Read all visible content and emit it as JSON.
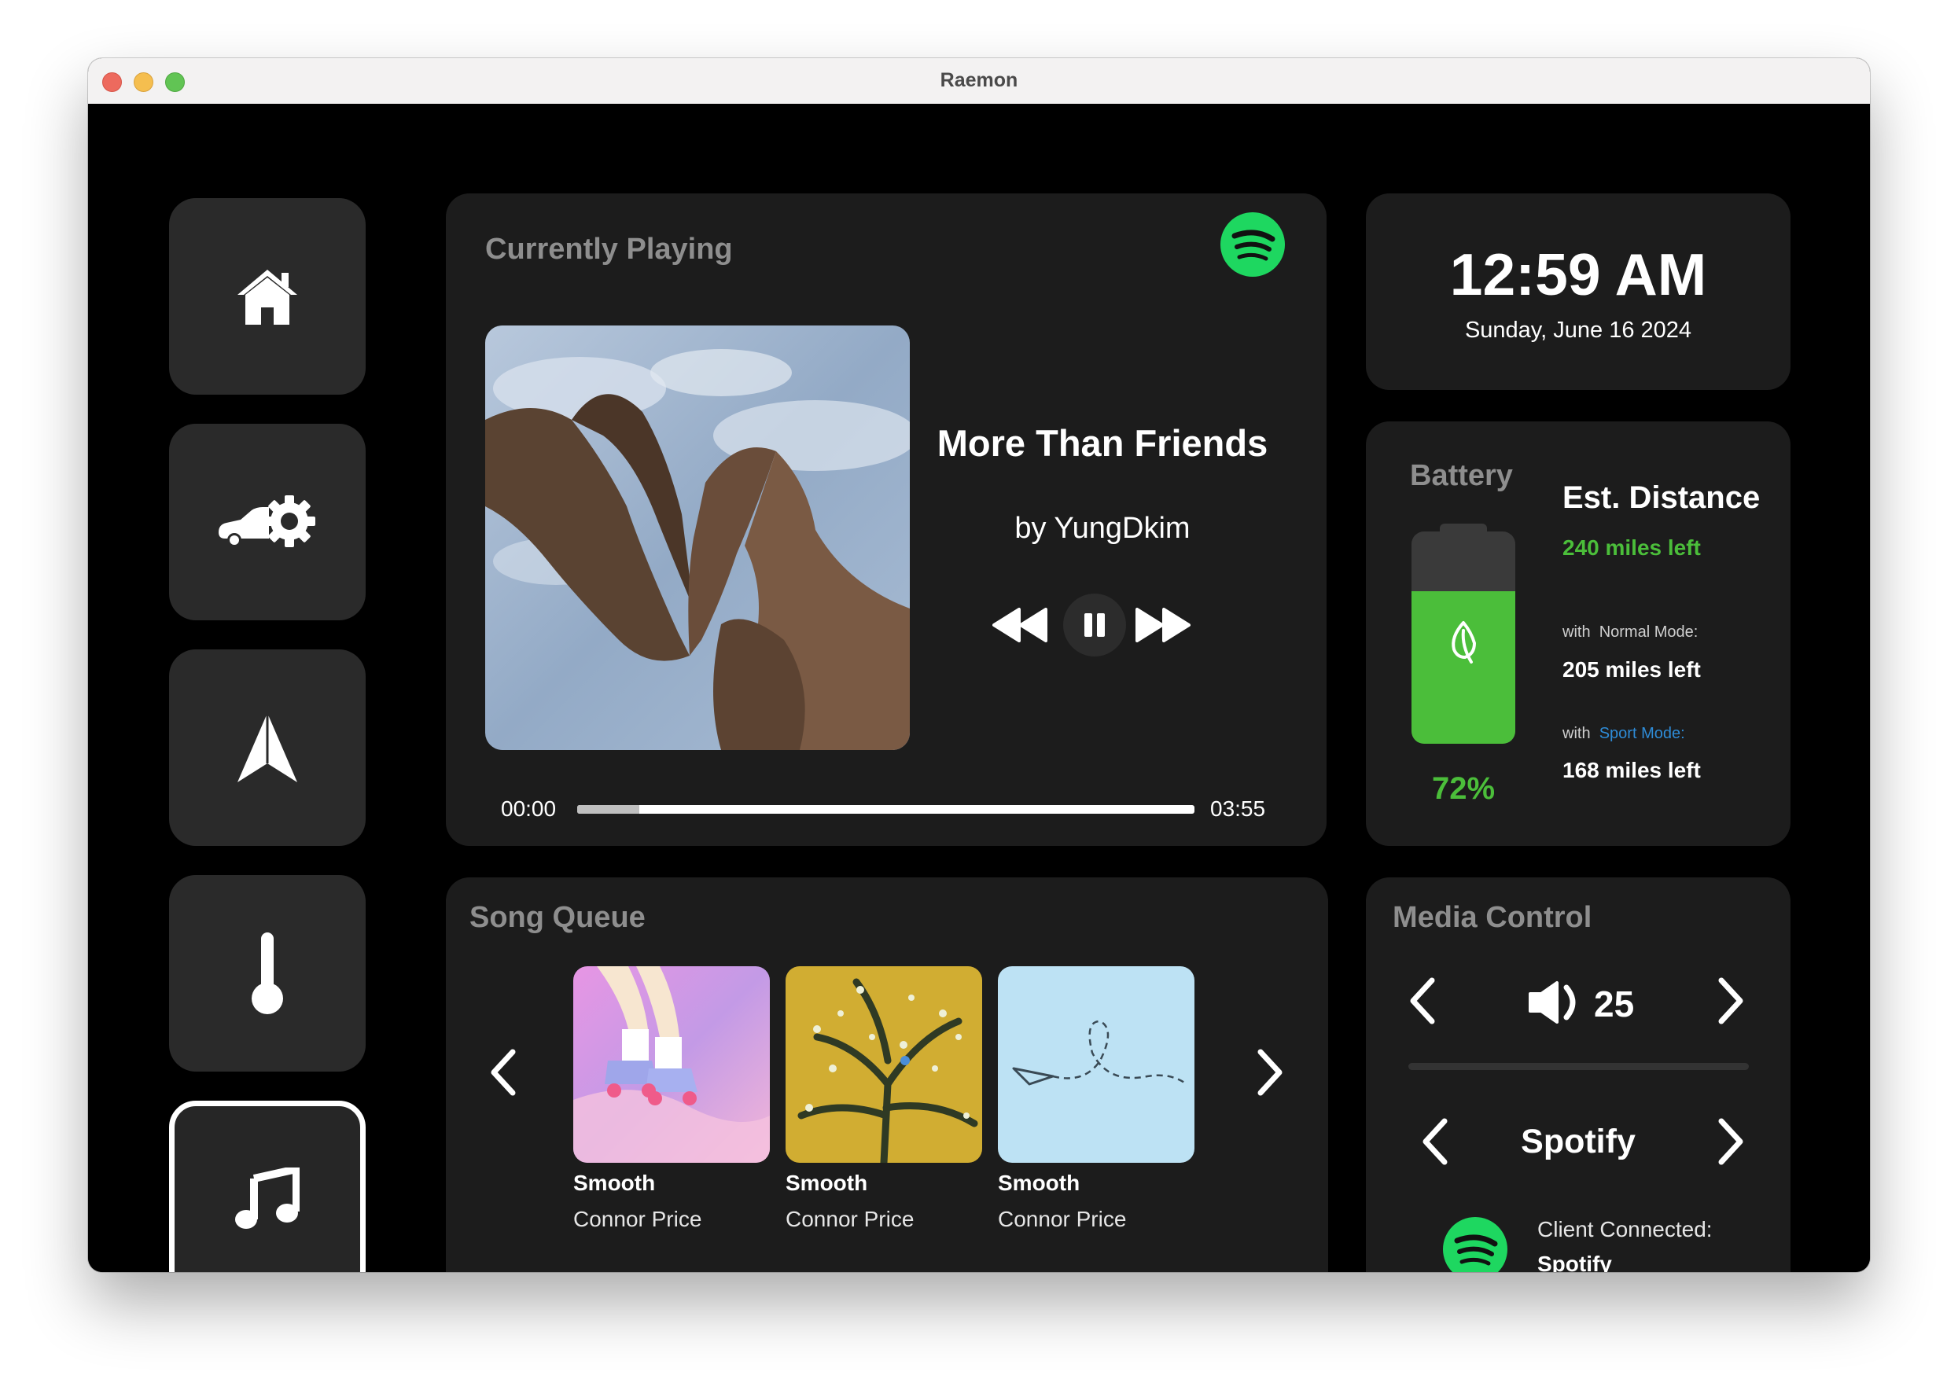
{
  "window": {
    "title": "Raemon"
  },
  "sidebar": {
    "items": [
      {
        "id": "home",
        "icon": "home-icon"
      },
      {
        "id": "car-settings",
        "icon": "car-settings-icon"
      },
      {
        "id": "navigation",
        "icon": "navigation-arrow-icon"
      },
      {
        "id": "climate",
        "icon": "thermometer-icon"
      },
      {
        "id": "music",
        "icon": "music-note-icon",
        "active": true
      }
    ]
  },
  "now_playing": {
    "header": "Currently Playing",
    "service_icon": "spotify-icon",
    "title": "More Than Friends",
    "artist": "by YungDkim",
    "elapsed": "00:00",
    "duration": "03:55",
    "progress_fraction": 0.1,
    "state": "playing"
  },
  "clock": {
    "time": "12:59 AM",
    "date": "Sunday, June 16 2024"
  },
  "battery": {
    "label": "Battery",
    "percent_text": "72%",
    "level": 0.72,
    "icon": "leaf-icon",
    "distance_header": "Est. Distance",
    "distance_main": "240 miles left",
    "modes": [
      {
        "prefix": "with",
        "name": "Normal Mode:",
        "miles": "205 miles left"
      },
      {
        "prefix": "with",
        "name": "Sport Mode:",
        "miles": "168 miles left"
      }
    ]
  },
  "queue": {
    "header": "Song Queue",
    "items": [
      {
        "title": "Smooth",
        "artist": "Connor Price"
      },
      {
        "title": "Smooth",
        "artist": "Connor Price"
      },
      {
        "title": "Smooth",
        "artist": "Connor Price"
      }
    ]
  },
  "media_control": {
    "header": "Media Control",
    "volume": "25",
    "source": "Spotify",
    "client_label": "Client Connected:",
    "client_name": "Spotify"
  },
  "colors": {
    "accent_green": "#4bbe3a",
    "spotify_green": "#1ed760",
    "sport_blue": "#2e8bd6",
    "card_bg": "#1c1c1c",
    "nav_bg": "#2a2a2a"
  }
}
